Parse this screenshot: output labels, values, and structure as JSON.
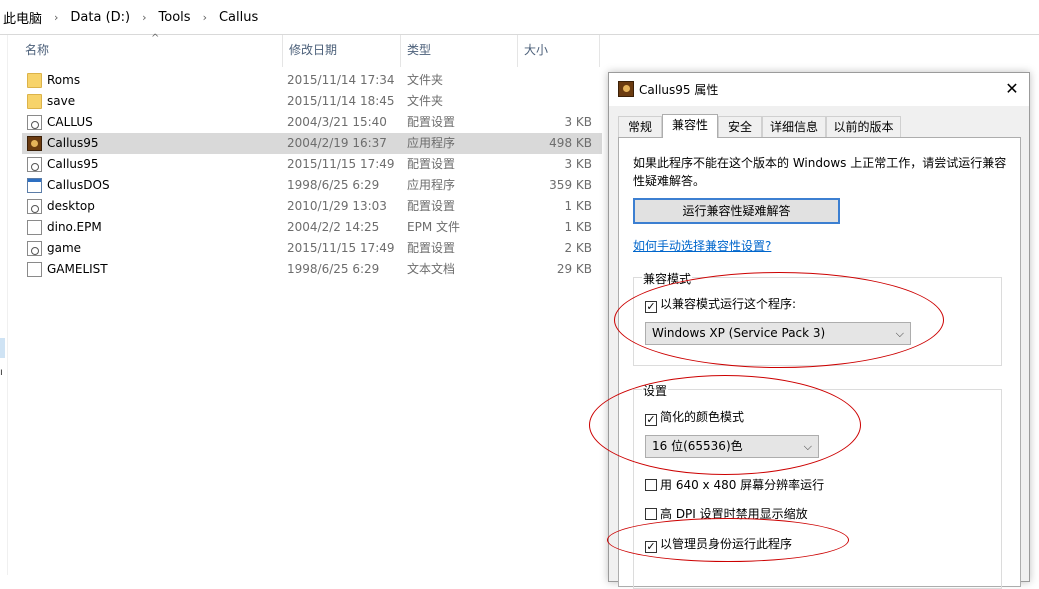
{
  "breadcrumb": {
    "items": [
      "此电脑",
      "Data (D:)",
      "Tools",
      "Callus"
    ],
    "separator": "›"
  },
  "left_strip_char": "ı",
  "columns": {
    "name": "名称",
    "date": "修改日期",
    "type": "类型",
    "size": "大小"
  },
  "files": [
    {
      "icon": "folder-icon",
      "name": "Roms",
      "date": "2015/11/14 17:34",
      "type": "文件夹",
      "size": ""
    },
    {
      "icon": "folder-icon",
      "name": "save",
      "date": "2015/11/14 18:45",
      "type": "文件夹",
      "size": ""
    },
    {
      "icon": "config-file-icon",
      "name": "CALLUS",
      "date": "2004/3/21 15:40",
      "type": "配置设置",
      "size": "3 KB"
    },
    {
      "icon": "callus-app-icon",
      "name": "Callus95",
      "date": "2004/2/19 16:37",
      "type": "应用程序",
      "size": "498 KB",
      "selected": true
    },
    {
      "icon": "config-file-icon",
      "name": "Callus95",
      "date": "2015/11/15 17:49",
      "type": "配置设置",
      "size": "3 KB"
    },
    {
      "icon": "dos-app-icon",
      "name": "CallusDOS",
      "date": "1998/6/25 6:29",
      "type": "应用程序",
      "size": "359 KB"
    },
    {
      "icon": "config-file-icon",
      "name": "desktop",
      "date": "2010/1/29 13:03",
      "type": "配置设置",
      "size": "1 KB"
    },
    {
      "icon": "blank-file-icon",
      "name": "dino.EPM",
      "date": "2004/2/2 14:25",
      "type": "EPM 文件",
      "size": "1 KB"
    },
    {
      "icon": "config-file-icon",
      "name": "game",
      "date": "2015/11/15 17:49",
      "type": "配置设置",
      "size": "2 KB"
    },
    {
      "icon": "blank-file-icon",
      "name": "GAMELIST",
      "date": "1998/6/25 6:29",
      "type": "文本文档",
      "size": "29 KB"
    }
  ],
  "dialog": {
    "title": "Callus95 属性",
    "close": "✕",
    "tabs": [
      "常规",
      "兼容性",
      "安全",
      "详细信息",
      "以前的版本"
    ],
    "active_tab": 1,
    "description": "如果此程序不能在这个版本的 Windows 上正常工作，请尝试运行兼容性疑难解答。",
    "troubleshoot_button": "运行兼容性疑难解答",
    "help_link": "如何手动选择兼容性设置?",
    "compat_group": {
      "label": "兼容模式",
      "checkbox_label": "以兼容模式运行这个程序:",
      "checked": true,
      "selected_os": "Windows XP (Service Pack 3)"
    },
    "settings_group": {
      "label": "设置",
      "reduced_color": {
        "label": "简化的颜色模式",
        "checked": true
      },
      "color_select": "16 位(65536)色",
      "res_640": {
        "label": "用 640 x 480 屏幕分辨率运行",
        "checked": false
      },
      "high_dpi": {
        "label": "高 DPI 设置时禁用显示缩放",
        "checked": false
      },
      "run_as_admin": {
        "label": "以管理员身份运行此程序",
        "checked": true
      }
    }
  },
  "colors": {
    "annotation": "#cc0000",
    "selection": "#d9d9d9",
    "link": "#0066cc",
    "button_border": "#3c7fd1"
  }
}
